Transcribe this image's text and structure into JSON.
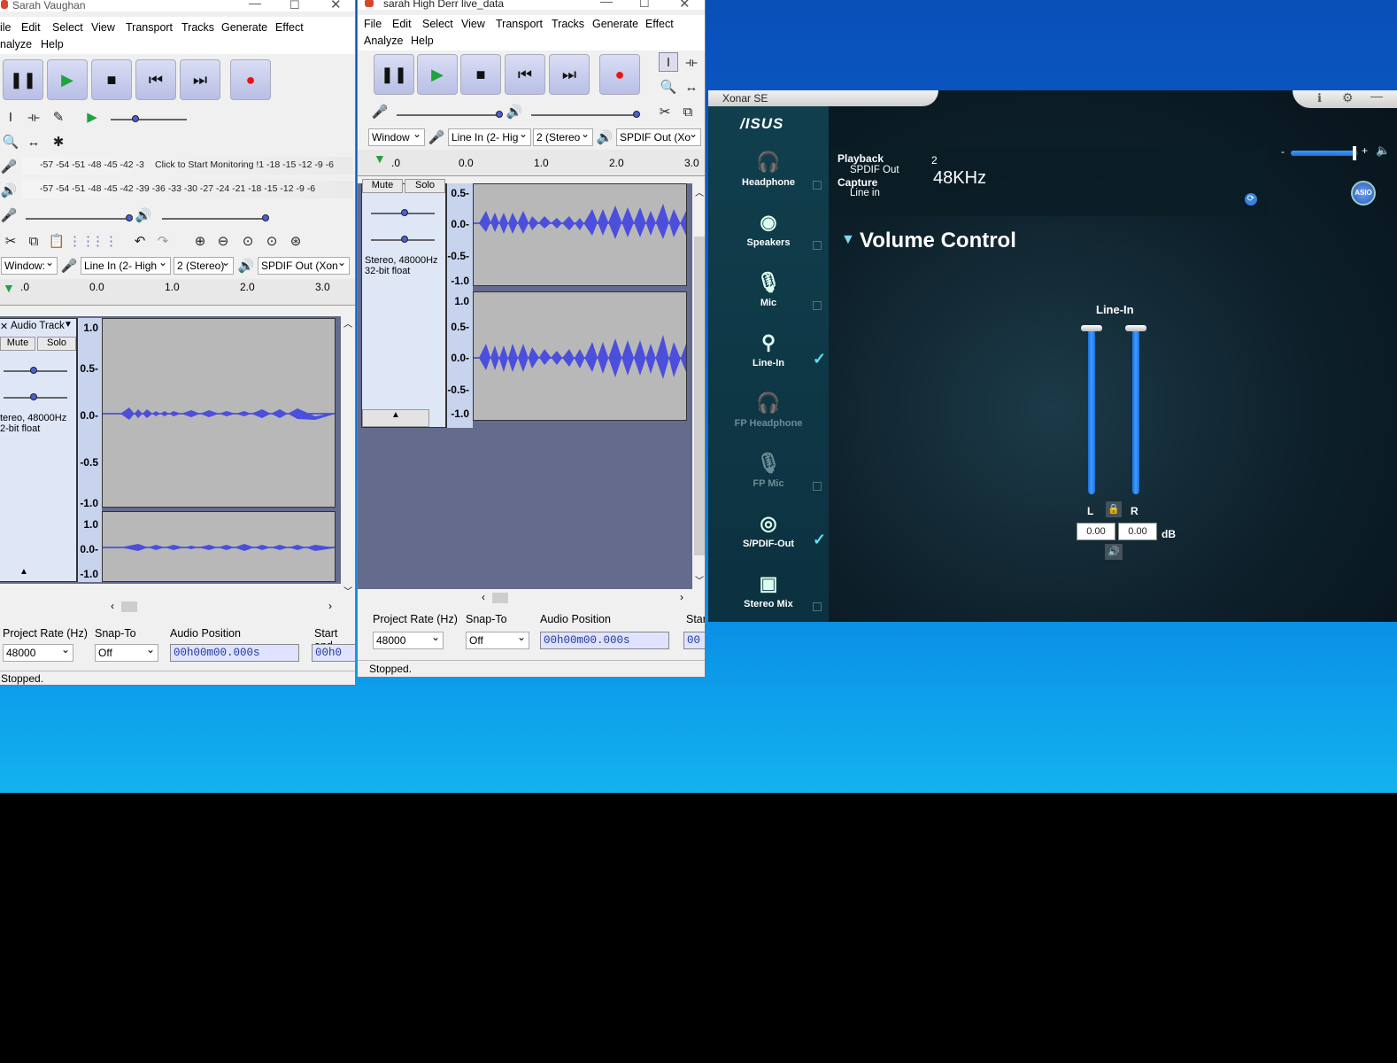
{
  "window1": {
    "title": "Sarah Vaughan",
    "menu": [
      "ile",
      "Edit",
      "Select",
      "View",
      "Transport",
      "Tracks",
      "Generate",
      "Effect",
      "nalyze",
      "Help"
    ],
    "meter_record": "-57 -54 -51 -48 -45 -42 -3",
    "meter_monitor": "Click to Start Monitoring !1 -18 -15 -12  -9  -6",
    "meter_play": "-57 -54 -51 -48 -45 -42 -39 -36 -33 -30 -27 -24 -21 -18 -15 -12  -9  -6",
    "host": "Window:",
    "rec_device": "Line In (2- High",
    "channels": "2 (Stereo)",
    "play_device": "SPDIF Out (Xon",
    "ruler": [
      ".0",
      "0.0",
      "1.0",
      "2.0",
      "3.0"
    ],
    "track_name": "Audio Track",
    "mute": "Mute",
    "solo": "Solo",
    "track_info": "tereo, 48000Hz\n2-bit float",
    "scale_top": [
      "1.0",
      "0.5-",
      "0.0-",
      "-0.5",
      "-1.0"
    ],
    "scale_bottom": [
      "1.0",
      "0.0-",
      "-1.0"
    ],
    "project_rate_label": "Project Rate (Hz)",
    "snap_label": "Snap-To",
    "audio_pos_label": "Audio Position",
    "start_label": "Start and",
    "rate": "48000",
    "snap": "Off",
    "audio_pos": "00h00m00.000s",
    "start_time": "00h0",
    "status": "Stopped."
  },
  "window2": {
    "title": "sarah High Derr live_data",
    "menu": [
      "File",
      "Edit",
      "Select",
      "View",
      "Transport",
      "Tracks",
      "Generate",
      "Effect",
      "Analyze",
      "Help"
    ],
    "host": "Window",
    "rec_device": "Line In (2- Hig",
    "channels": "2 (Stereo",
    "play_device": "SPDIF Out (Xo",
    "ruler": [
      ".0",
      "0.0",
      "1.0",
      "2.0",
      "3.0"
    ],
    "mute": "Mute",
    "solo": "Solo",
    "track_info": "Stereo, 48000Hz\n32-bit float",
    "scale_top": [
      "0.5-",
      "0.0-",
      "-0.5-",
      "-1.0"
    ],
    "scale_bottom": [
      "1.0",
      "0.5-",
      "0.0-",
      "-0.5-",
      "-1.0"
    ],
    "project_rate_label": "Project Rate (Hz)",
    "snap_label": "Snap-To",
    "audio_pos_label": "Audio Position",
    "start_label": "Star",
    "rate": "48000",
    "snap": "Off",
    "audio_pos": "00h00m00.000s",
    "start_time": "00",
    "status": "Stopped."
  },
  "xonar": {
    "title": "Xonar SE",
    "logo": "/ISUS",
    "nav": [
      {
        "label": "Headphone",
        "icon": "headphone-icon",
        "glyph": "🎧",
        "dim": false,
        "checked": false
      },
      {
        "label": "Speakers",
        "icon": "speaker-icon",
        "glyph": "◉",
        "dim": false,
        "checked": false
      },
      {
        "label": "Mic",
        "icon": "mic-icon",
        "glyph": "🎙",
        "dim": false,
        "checked": false
      },
      {
        "label": "Line-In",
        "icon": "line-in-icon",
        "glyph": "⚲",
        "dim": false,
        "checked": true
      },
      {
        "label": "FP Headphone",
        "icon": "fp-headphone-icon",
        "glyph": "🎧",
        "dim": true,
        "checked": false
      },
      {
        "label": "FP Mic",
        "icon": "fp-mic-icon",
        "glyph": "🎙",
        "dim": true,
        "checked": false
      },
      {
        "label": "S/PDIF-Out",
        "icon": "spdif-icon",
        "glyph": "◎",
        "dim": false,
        "checked": true
      },
      {
        "label": "Stereo Mix",
        "icon": "stereo-mix-icon",
        "glyph": "▣",
        "dim": false,
        "checked": false
      }
    ],
    "playback_label": "Playback",
    "playback_device": "SPDIF Out",
    "capture_label": "Capture",
    "capture_device": "Line in",
    "channels": "2",
    "sample_rate": "48KHz",
    "asio": "ASIO",
    "section_title": "Volume Control",
    "channel_name": "Line-In",
    "left_label": "L",
    "right_label": "R",
    "left_db": "0.00",
    "right_db": "0.00",
    "db_unit": "dB",
    "left_level": 1.0,
    "right_level": 1.0,
    "master_level": 0.95
  }
}
